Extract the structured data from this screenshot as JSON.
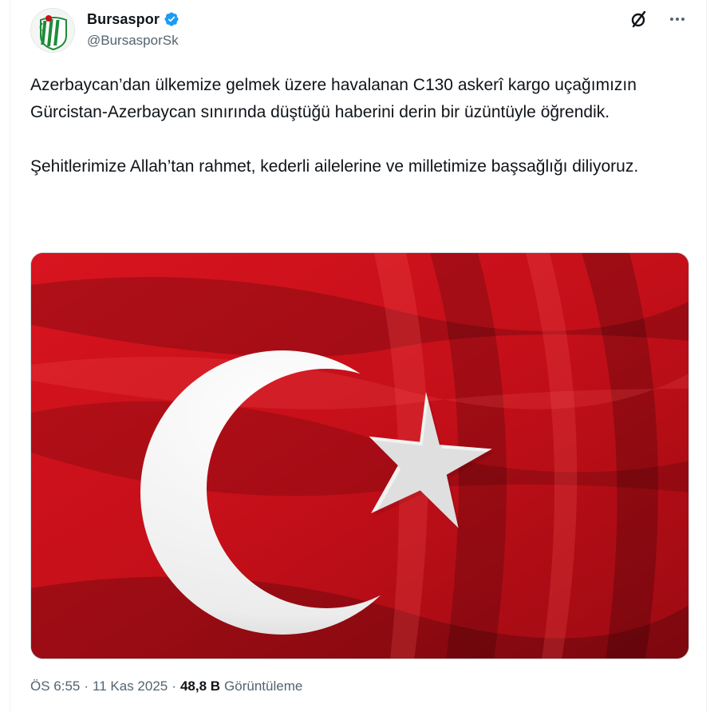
{
  "author": {
    "display_name": "Bursaspor",
    "handle": "@BursasporSk",
    "verified": true
  },
  "tweet": {
    "paragraphs": [
      "Azerbaycan’dan ülkemize gelmek üzere havalanan C130 askerî kargo uçağımızın Gürcistan-Azerbaycan sınırında düştüğü haberini derin bir üzüntüyle öğrendik.",
      "Şehitlerimize Allah’tan rahmet, kederli ailelerine ve milletimize başsağlığı diliyoruz."
    ]
  },
  "media": {
    "subject": "Turkish flag",
    "colors": {
      "red": "#c8101a",
      "white": "#f4f4f4"
    }
  },
  "meta": {
    "time": "ÖS 6:55",
    "date": "11 Kas 2025",
    "separator": "·",
    "views_count": "48,8 B",
    "views_label": "Görüntüleme"
  },
  "icons": {
    "grok": "grok-icon",
    "more": "more-icon",
    "verified": "verified-badge-icon"
  },
  "colors": {
    "text": "#0f1419",
    "secondary": "#536471",
    "verified": "#1d9bf0",
    "avatar_green": "#1e8c3a"
  }
}
